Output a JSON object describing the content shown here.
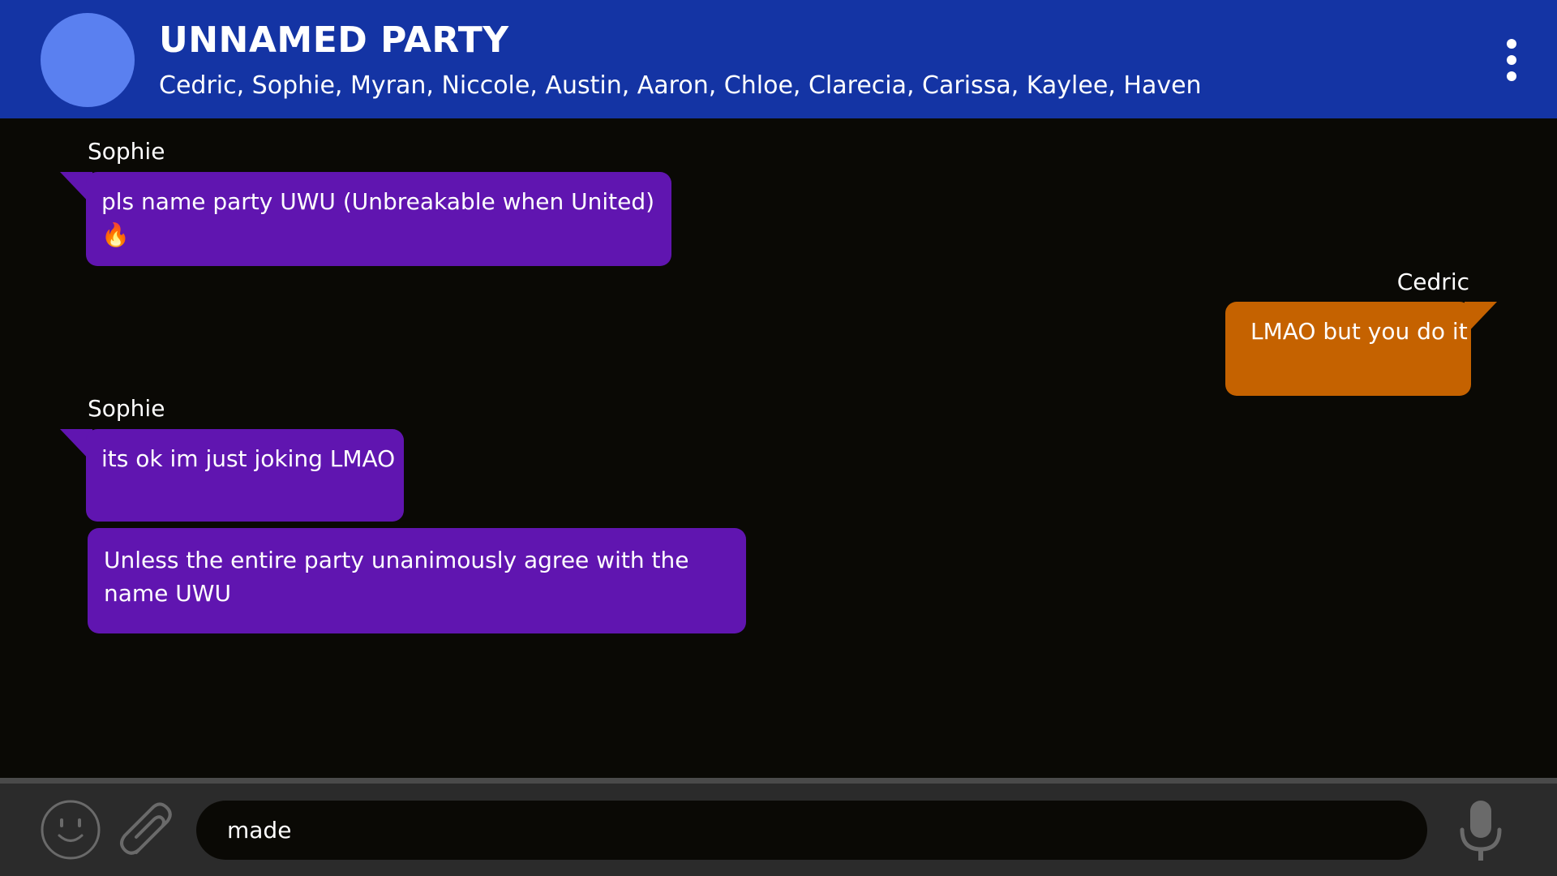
{
  "header": {
    "title": "UNNAMED PARTY",
    "members": "Cedric, Sophie, Myran, Niccole, Austin, Aaron, Chloe, Clarecia, Carissa, Kaylee, Haven",
    "avatar_color": "#5a80f0",
    "background": "#1434a4",
    "menu_icon": "more-vertical-icon"
  },
  "messages": [
    {
      "sender": "Sophie",
      "side": "left",
      "bubbles": [
        "pls name party UWU (Unbreakable when United)🔥"
      ],
      "color": "#6015b0"
    },
    {
      "sender": "Cedric",
      "side": "right",
      "bubbles": [
        "LMAO but you do it"
      ],
      "color": "#c56200"
    },
    {
      "sender": "Sophie",
      "side": "left",
      "bubbles": [
        "its ok im just joking LMAO",
        "Unless the entire party unanimously agree with the name UWU"
      ],
      "color": "#6015b0"
    }
  ],
  "composer": {
    "value": "made",
    "emoji_icon": "smiley-icon",
    "attach_icon": "paperclip-icon",
    "mic_icon": "microphone-icon"
  }
}
